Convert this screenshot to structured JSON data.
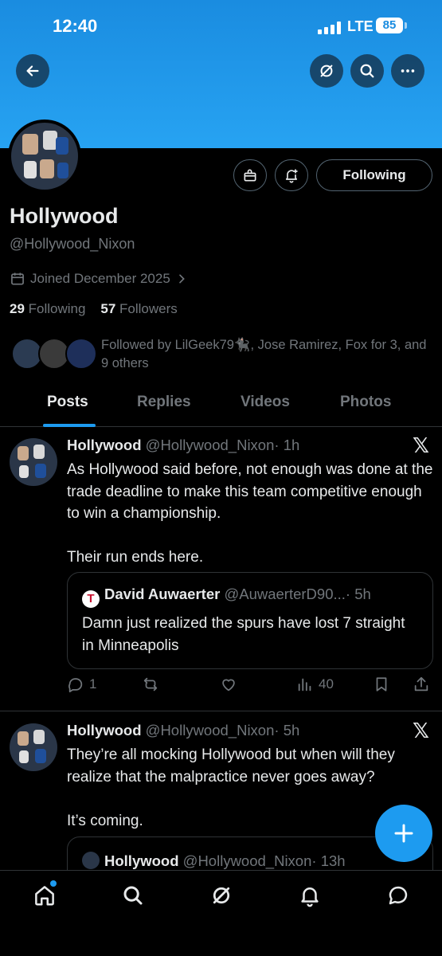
{
  "status_bar": {
    "time": "12:40",
    "network": "LTE",
    "battery": "85"
  },
  "colors": {
    "accent": "#1d9bf0",
    "banner": "#1a8ce0",
    "muted": "#71767b",
    "text": "#e7e9ea",
    "border": "#2f3336"
  },
  "top_bar": {
    "back_icon": "arrow-left-icon",
    "grok_icon": "grok-icon",
    "search_icon": "search-icon",
    "more_icon": "more-icon"
  },
  "profile": {
    "name": "Hollywood",
    "handle": "@Hollywood_Nixon",
    "joined": "Joined December 2025",
    "following_count": "29",
    "following_label": "Following",
    "followers_count": "57",
    "followers_label": "Followers",
    "followed_by": "Followed by LilGeek79🐈‍⬛, Jose Ramirez, Fox for 3, and 9 others",
    "follow_button": "Following"
  },
  "tabs": [
    {
      "label": "Posts",
      "active": true
    },
    {
      "label": "Replies",
      "active": false
    },
    {
      "label": "Videos",
      "active": false
    },
    {
      "label": "Photos",
      "active": false
    }
  ],
  "posts": [
    {
      "author": "Hollywood",
      "handle": "@Hollywood_Nixon",
      "time": "· 1h",
      "text": "As Hollywood said before, not enough was done at the trade deadline to make this team competitive enough to win a championship.\n\nTheir run ends here.",
      "quote": {
        "author": "David Auwaerter",
        "handle": "@AuwaerterD90...",
        "time": "· 5h",
        "text": "Damn just realized the spurs have lost 7 straight in Minneapolis"
      },
      "replies": "1",
      "reposts": "",
      "likes": "",
      "views": "40"
    },
    {
      "author": "Hollywood",
      "handle": "@Hollywood_Nixon",
      "time": "· 5h",
      "text": "They’re all mocking Hollywood but when will they realize that the malpractice never goes away?\n\nIt’s coming.",
      "quote": {
        "author": "Hollywood",
        "handle": "@Hollywood_Nixon",
        "time": "· 13h"
      }
    }
  ],
  "bottom_nav": [
    "home-icon",
    "search-icon",
    "grok-icon",
    "notifications-icon",
    "messages-icon"
  ]
}
